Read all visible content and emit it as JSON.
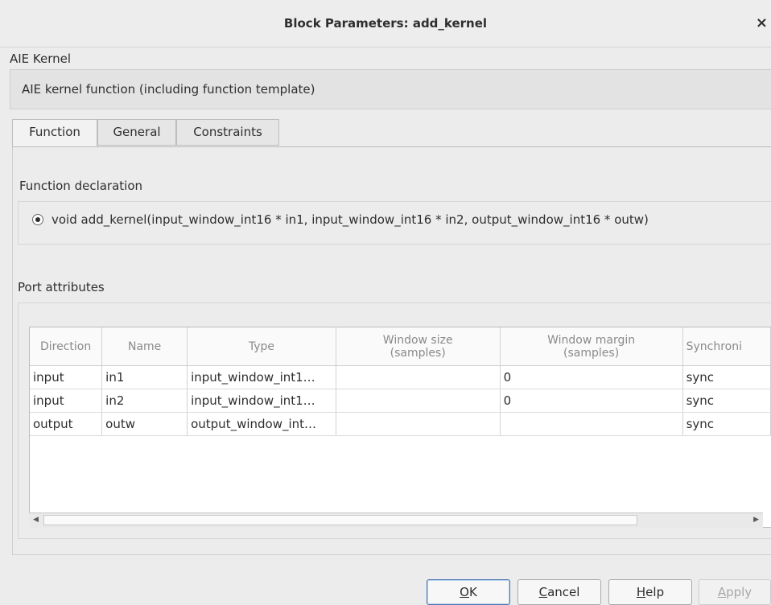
{
  "window": {
    "title": "Block Parameters: add_kernel",
    "close_glyph": "×"
  },
  "kernel_label": "AIE Kernel",
  "description": "AIE kernel function (including function template)",
  "tabs": [
    {
      "label": "Function",
      "active": true
    },
    {
      "label": "General",
      "active": false
    },
    {
      "label": "Constraints",
      "active": false
    }
  ],
  "function_declaration": {
    "label": "Function declaration",
    "options": [
      "void add_kernel(input_window_int16 * in1, input_window_int16 * in2, output_window_int16 * outw)"
    ],
    "selected_index": 0
  },
  "port_attributes": {
    "label": "Port attributes",
    "columns": [
      {
        "line1": "Direction",
        "line2": ""
      },
      {
        "line1": "Name",
        "line2": ""
      },
      {
        "line1": "Type",
        "line2": ""
      },
      {
        "line1": "Window size",
        "line2": "(samples)"
      },
      {
        "line1": "Window margin",
        "line2": "(samples)"
      },
      {
        "line1": "Synchroni",
        "line2": ""
      }
    ],
    "rows": [
      [
        "input",
        "in1",
        "input_window_int1…",
        "",
        "0",
        "sync"
      ],
      [
        "input",
        "in2",
        "input_window_int1…",
        "",
        "0",
        "sync"
      ],
      [
        "output",
        "outw",
        "output_window_int…",
        "",
        "",
        "sync"
      ]
    ]
  },
  "buttons": {
    "ok": {
      "mnemonic": "O",
      "rest": "K"
    },
    "cancel": {
      "mnemonic": "C",
      "rest": "ancel"
    },
    "help": {
      "mnemonic": "H",
      "rest": "elp"
    },
    "apply": {
      "mnemonic": "A",
      "rest": "pply",
      "disabled": true
    }
  }
}
